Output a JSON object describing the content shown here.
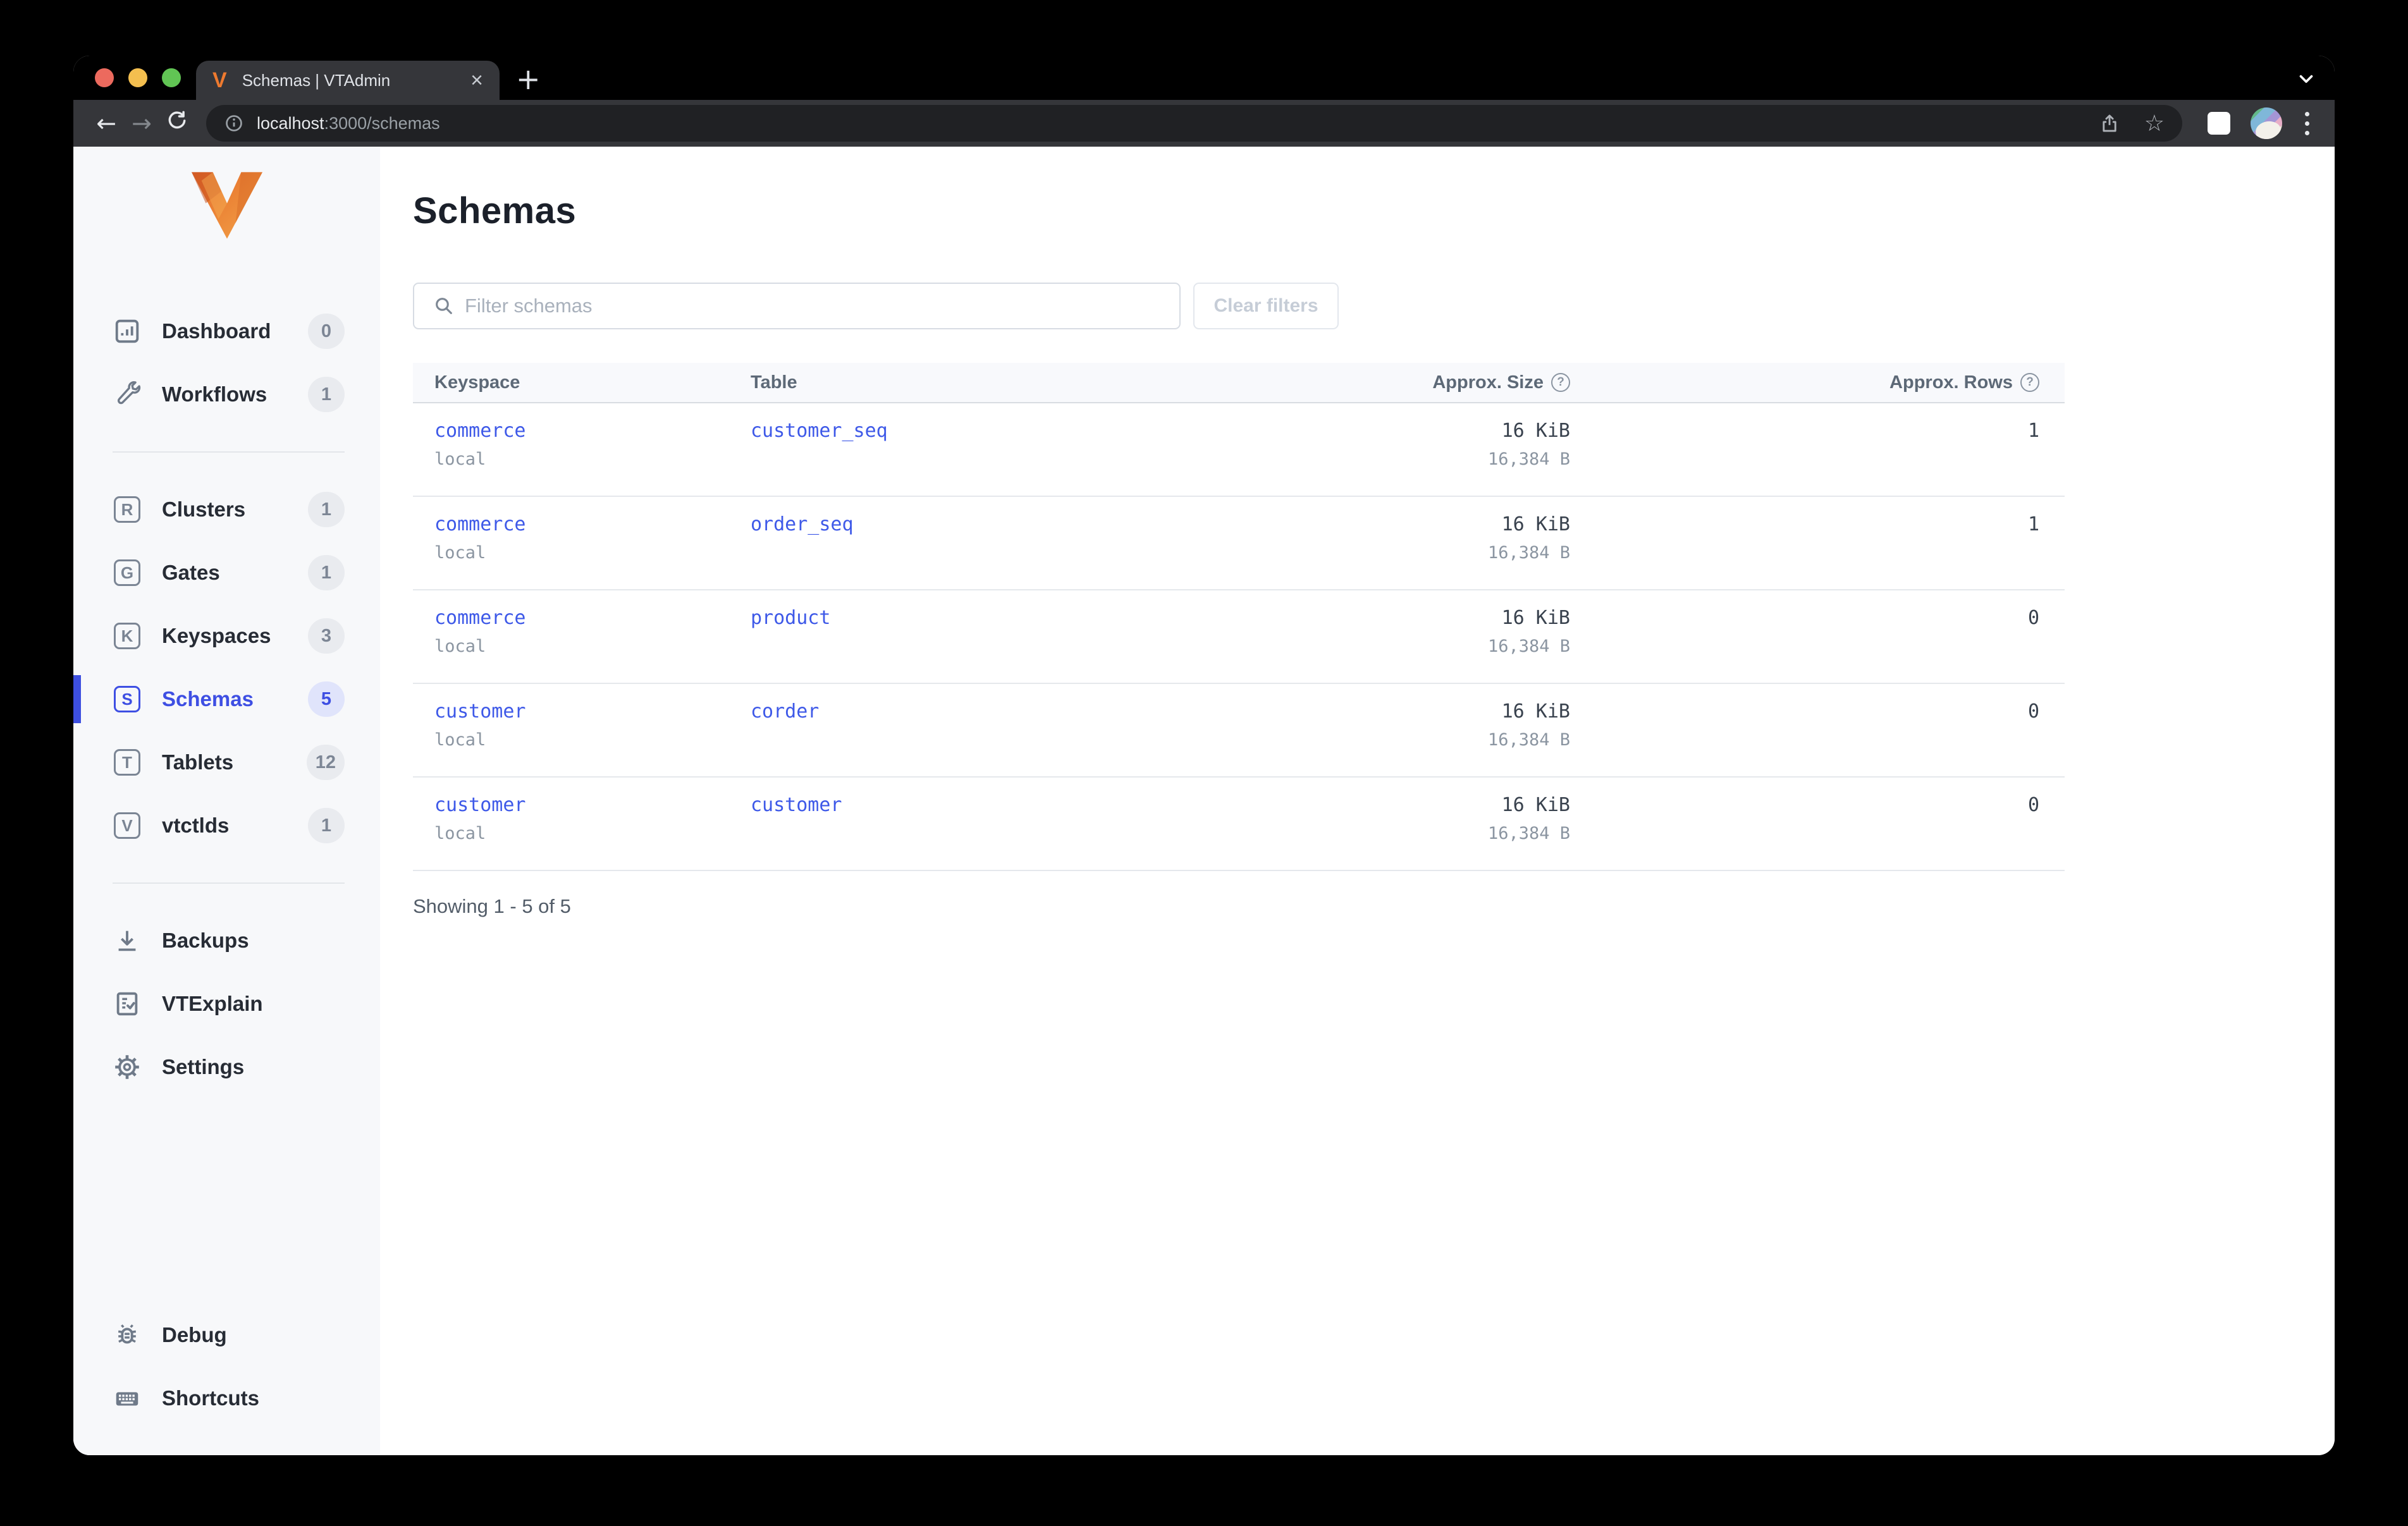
{
  "colors": {
    "accent": "#3e4fe3",
    "link_blue": "#3e59e8",
    "active_bar": "#3d4fe0",
    "badge_bg": "#e9ebef",
    "active_badge_bg": "#e0e4fb",
    "chrome_bg": "#35363a",
    "tabstrip_bg": "#000000",
    "urlbar_bg": "#202124",
    "sidebar_bg": "#f7f8fa",
    "table_header_bg": "#f8f9fc",
    "logo_orange": "#ee7a2f"
  },
  "browser": {
    "tab": {
      "title": "Schemas | VTAdmin",
      "favicon_letter": "V",
      "close_icon": "×"
    },
    "new_tab_icon": "+",
    "toolbar": {
      "back_icon": "←",
      "forward_icon": "→",
      "url_host": "localhost",
      "url_rest": ":3000/schemas",
      "star_icon": "☆"
    }
  },
  "sidebar": {
    "items": [
      {
        "label": "Dashboard",
        "count": "0",
        "icon": "dashboard-icon"
      },
      {
        "label": "Workflows",
        "count": "1",
        "icon": "wrench-icon"
      },
      {
        "label": "Clusters",
        "count": "1",
        "icon_letter": "R"
      },
      {
        "label": "Gates",
        "count": "1",
        "icon_letter": "G"
      },
      {
        "label": "Keyspaces",
        "count": "3",
        "icon_letter": "K"
      },
      {
        "label": "Schemas",
        "count": "5",
        "icon_letter": "S",
        "active": true
      },
      {
        "label": "Tablets",
        "count": "12",
        "icon_letter": "T"
      },
      {
        "label": "vtctlds",
        "count": "1",
        "icon_letter": "V"
      },
      {
        "label": "Backups",
        "icon": "download-icon"
      },
      {
        "label": "VTExplain",
        "icon": "doc-check-icon"
      },
      {
        "label": "Settings",
        "icon": "gear-icon"
      }
    ],
    "footer_items": [
      {
        "label": "Debug",
        "icon": "bug-icon"
      },
      {
        "label": "Shortcuts",
        "icon": "keyboard-icon"
      }
    ]
  },
  "main": {
    "title": "Schemas",
    "search": {
      "placeholder": "Filter schemas"
    },
    "clear_button": "Clear filters",
    "table": {
      "columns": [
        "Keyspace",
        "Table",
        "Approx. Size",
        "Approx. Rows"
      ],
      "help_icon": "?",
      "rows": [
        {
          "keyspace": "commerce",
          "cluster": "local",
          "table": "customer_seq",
          "size": "16 KiB",
          "size_bytes": "16,384 B",
          "row_count": "1"
        },
        {
          "keyspace": "commerce",
          "cluster": "local",
          "table": "order_seq",
          "size": "16 KiB",
          "size_bytes": "16,384 B",
          "row_count": "1"
        },
        {
          "keyspace": "commerce",
          "cluster": "local",
          "table": "product",
          "size": "16 KiB",
          "size_bytes": "16,384 B",
          "row_count": "0"
        },
        {
          "keyspace": "customer",
          "cluster": "local",
          "table": "corder",
          "size": "16 KiB",
          "size_bytes": "16,384 B",
          "row_count": "0"
        },
        {
          "keyspace": "customer",
          "cluster": "local",
          "table": "customer",
          "size": "16 KiB",
          "size_bytes": "16,384 B",
          "row_count": "0"
        }
      ],
      "summary": "Showing 1 - 5 of 5"
    }
  }
}
